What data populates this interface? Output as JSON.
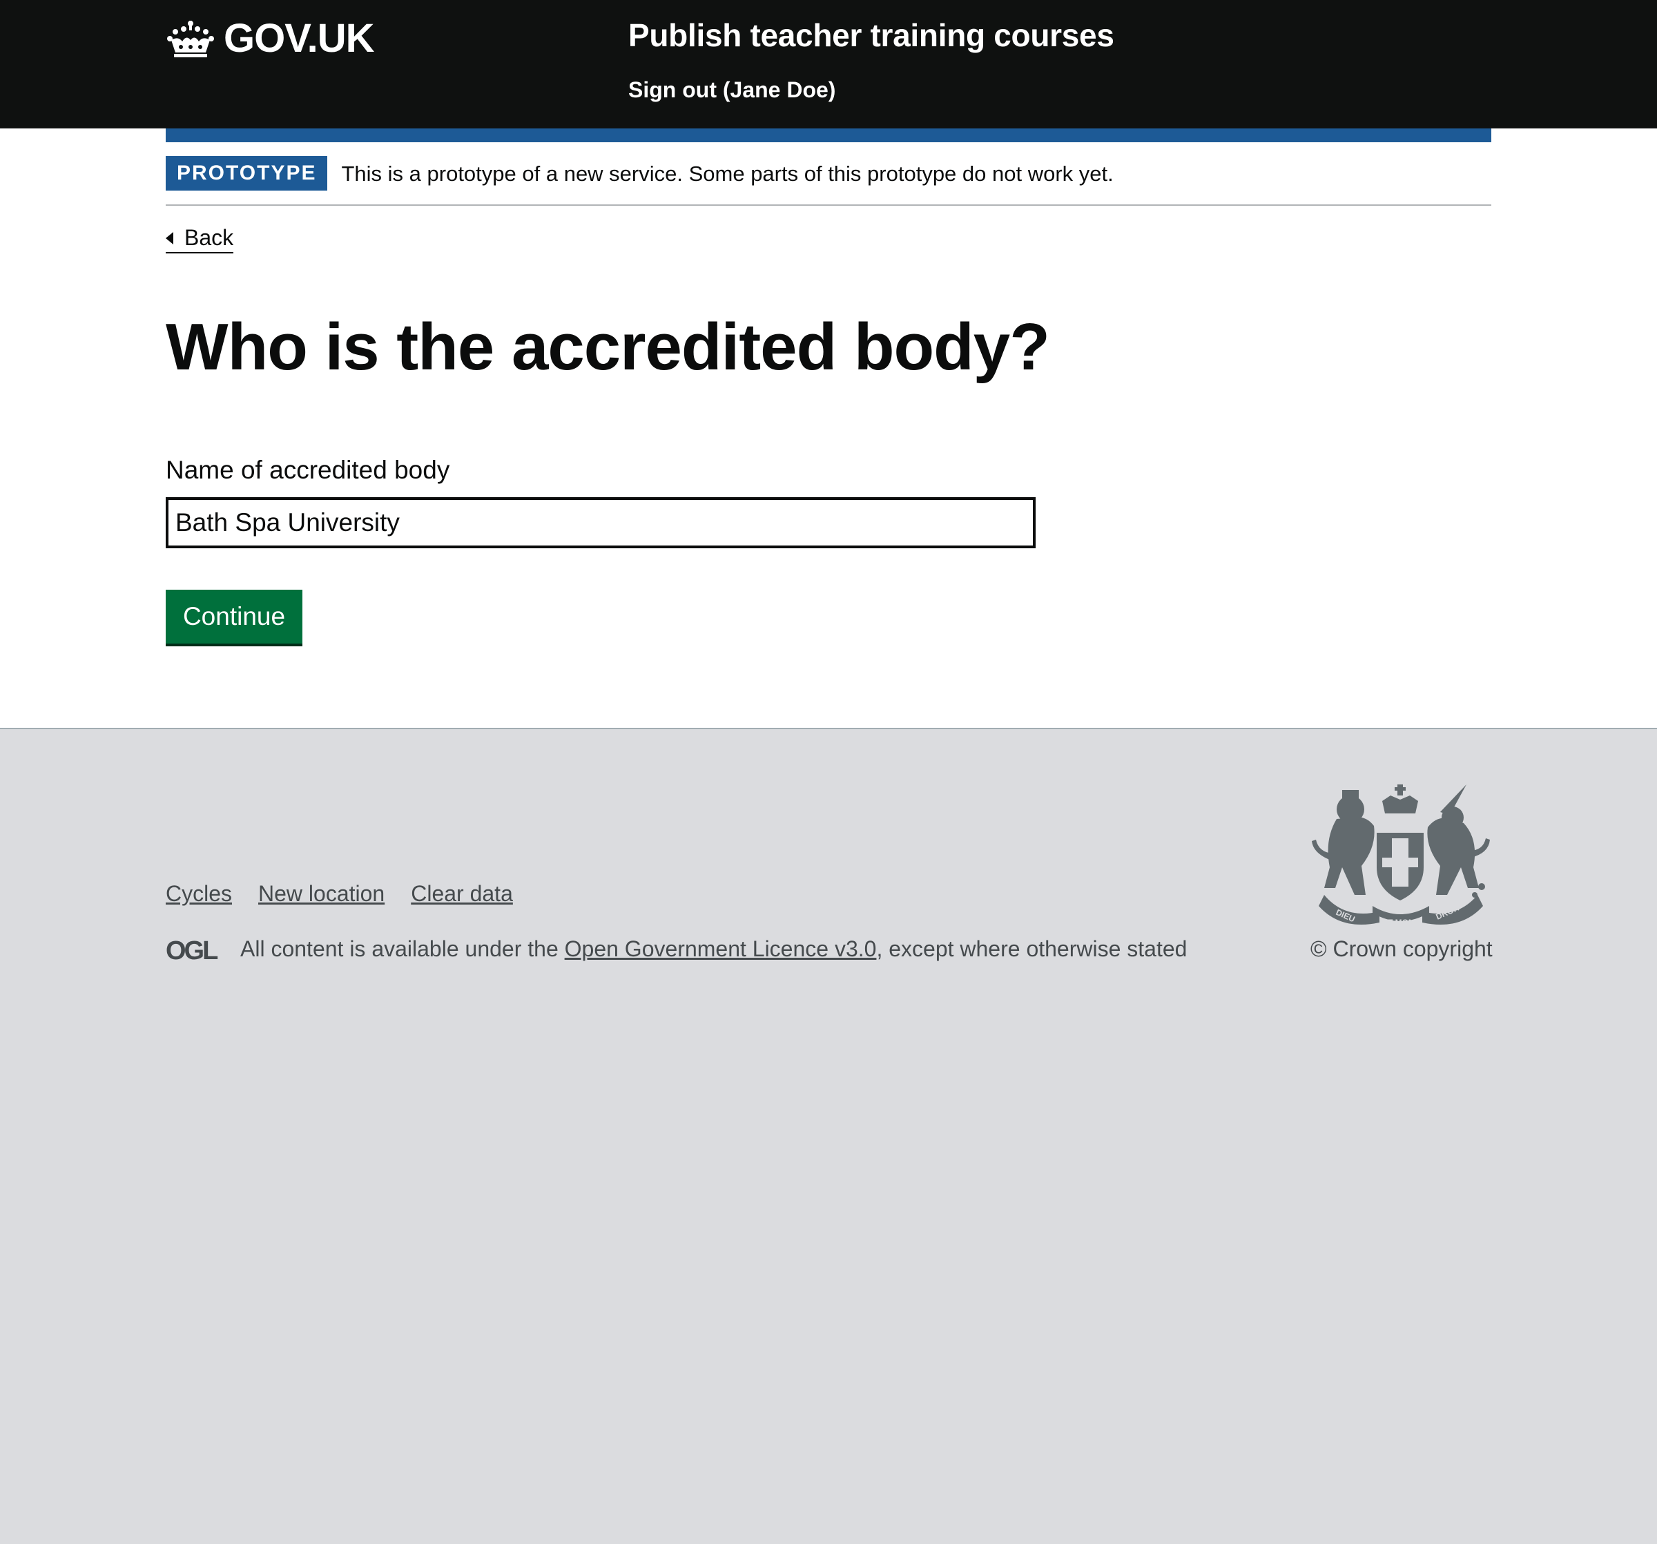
{
  "header": {
    "logo_text": "GOV.UK",
    "service_name": "Publish teacher training courses",
    "sign_out": "Sign out (Jane Doe)"
  },
  "phase_banner": {
    "tag": "PROTOTYPE",
    "text": "This is a prototype of a new service. Some parts of this prototype do not work yet."
  },
  "back_link": "Back",
  "page": {
    "title": "Who is the accredited body?",
    "field_label": "Name of accredited body",
    "field_value": "Bath Spa University",
    "continue_label": "Continue"
  },
  "footer": {
    "links": [
      "Cycles",
      "New location",
      "Clear data"
    ],
    "ogl_label": "OGL",
    "licence_prefix": "All content is available under the ",
    "licence_link": "Open Government Licence v3.0",
    "licence_suffix": ", except where otherwise stated",
    "copyright": "© Crown copyright",
    "crest_motto": [
      "DIEU",
      "ET MON",
      "DROIT"
    ]
  },
  "colors": {
    "header_bg": "#0f1110",
    "brand_blue": "#1d5a96",
    "button_green": "#00703c",
    "footer_bg": "#dbdcdf",
    "footer_text": "#454a4d"
  }
}
